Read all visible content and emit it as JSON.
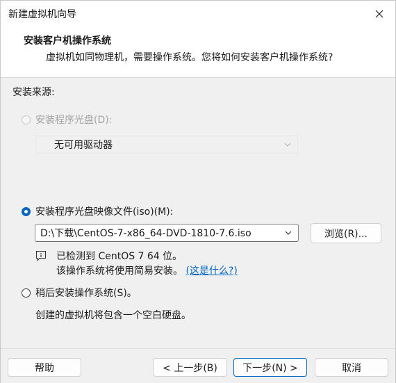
{
  "window": {
    "title": "新建虚拟机向导"
  },
  "header": {
    "title": "安装客户机操作系统",
    "description": "虚拟机如同物理机，需要操作系统。您将如何安装客户机操作系统?"
  },
  "source": {
    "label": "安装来源:",
    "disc": {
      "label": "安装程序光盘(D):",
      "selected": false,
      "enabled": false,
      "drive_value": "无可用驱动器"
    },
    "iso": {
      "label": "安装程序光盘映像文件(iso)(M):",
      "selected": true,
      "path_value": "D:\\下载\\CentOS-7-x86_64-DVD-1810-7.6.iso",
      "browse_label": "浏览(R)...",
      "detected_text": "已检测到 CentOS 7 64 位。",
      "easy_install_text": "该操作系统将使用简易安装。",
      "what_is_this_link": "(这是什么?)"
    },
    "later": {
      "label": "稍后安装操作系统(S)。",
      "selected": false,
      "note": "创建的虚拟机将包含一个空白硬盘。"
    }
  },
  "footer": {
    "help_label": "帮助",
    "back_label": "< 上一步(B)",
    "next_label": "下一步(N) >",
    "cancel_label": "取消"
  },
  "colors": {
    "accent": "#0067c0",
    "window_bg": "#f0f0f0",
    "header_bg": "#ffffff",
    "disabled_text": "#a3a3a3"
  },
  "icons": {
    "close": "close-icon",
    "info": "info-icon",
    "dropdown": "chevron-down-icon"
  }
}
